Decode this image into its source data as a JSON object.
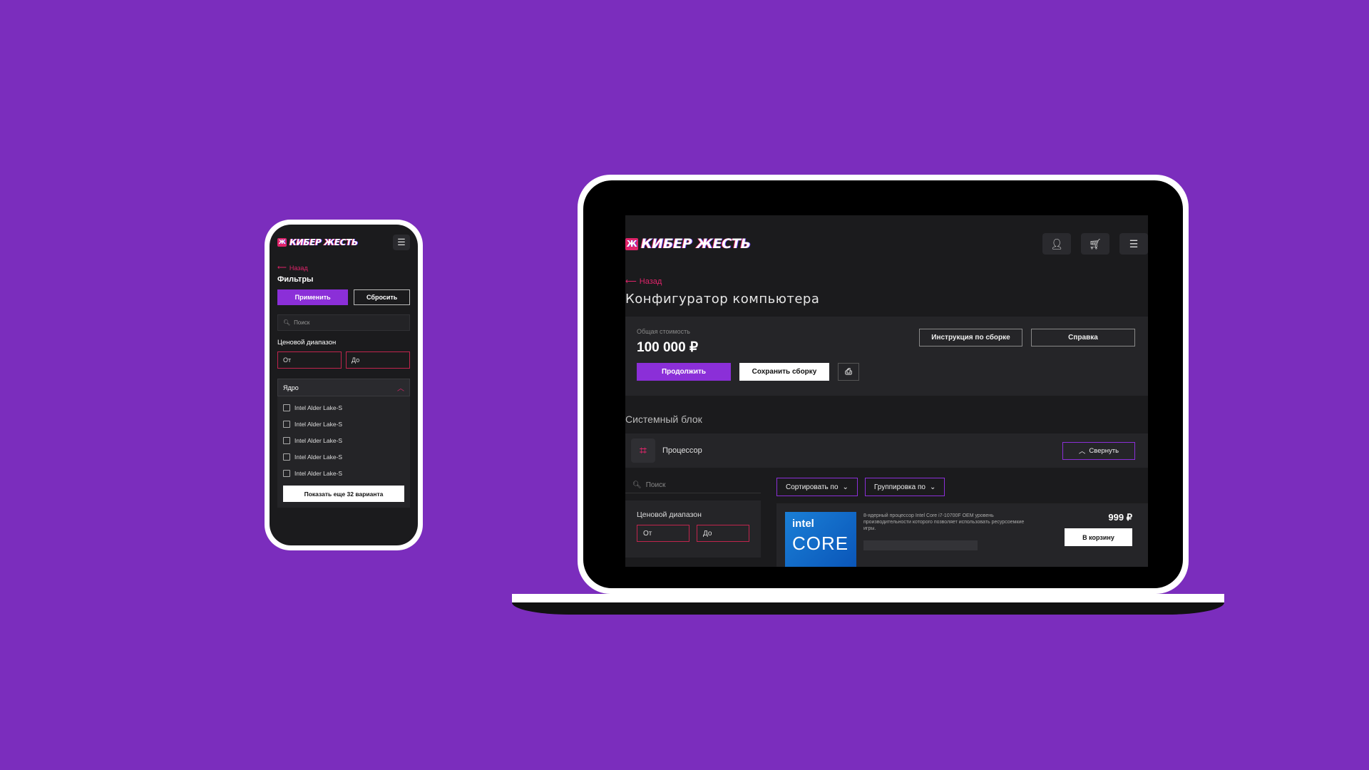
{
  "colors": {
    "background": "#7b2dbd",
    "accent": "#8b2fd8",
    "brand_red": "#e0246a",
    "screen_bg": "#1b1b1d"
  },
  "brand": {
    "name": "КИБЕР ЖЕСТЬ",
    "mark": "Ж"
  },
  "phone": {
    "back_label": "Назад",
    "title": "Фильтры",
    "apply_label": "Применить",
    "reset_label": "Сбросить",
    "search_placeholder": "Поиск",
    "price_label": "Ценовой диапазон",
    "from_placeholder": "От",
    "to_placeholder": "До",
    "accordion_label": "Ядро",
    "options": [
      "Intel Alder Lake-S",
      "Intel Alder Lake-S",
      "Intel Alder Lake-S",
      "Intel Alder Lake-S",
      "Intel Alder Lake-S"
    ],
    "more_label": "Показать еще 32 варианта",
    "icons": {
      "menu": "burger-icon",
      "back": "arrow-left-icon",
      "search": "search-icon",
      "chevron": "chevron-up-icon"
    }
  },
  "laptop": {
    "back_label": "Назад",
    "page_title": "Конфигуратор компьютера",
    "cost_label": "Общая стоимость",
    "cost_value": "100 000 ₽",
    "continue_label": "Продолжить",
    "save_label": "Сохранить сборку",
    "instructions_label": "Инструкция по сборке",
    "help_label": "Справка",
    "section_title": "Системный блок",
    "category_label": "Процессор",
    "collapse_label": "Свернуть",
    "search_placeholder": "Поиск",
    "sort_label": "Сортировать по",
    "group_label": "Группировка по",
    "price_label": "Ценовой диапазон",
    "from_placeholder": "От",
    "to_placeholder": "До",
    "product": {
      "brand": "intel",
      "series": "CORE",
      "description": "8-ядерный процессор Intel Core i7-10700F OEM уровень производительности которого позволяет использовать ресурсоемкие игры.",
      "price": "999 ₽",
      "cart_label": "В корзину"
    },
    "icons": {
      "user": "user-icon",
      "cart": "cart-icon",
      "menu": "burger-icon",
      "cpu": "cpu-icon",
      "print": "print-icon"
    }
  }
}
